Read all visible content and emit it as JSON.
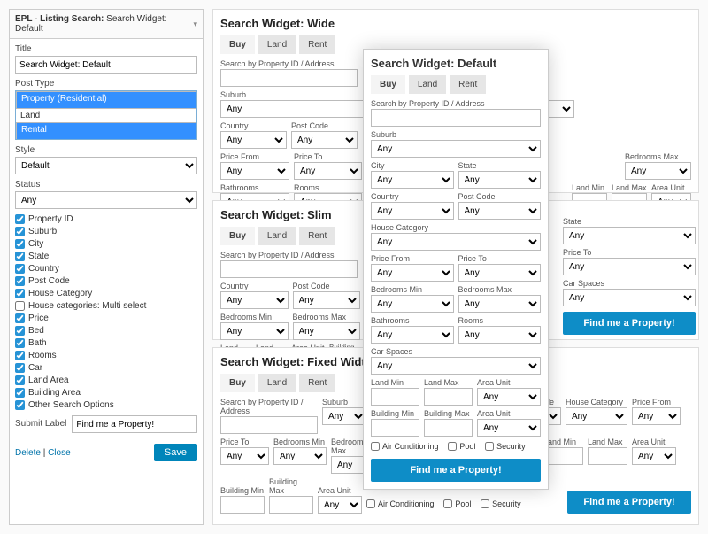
{
  "sidebar": {
    "header_prefix": "EPL - Listing Search:",
    "header_name": "Search Widget: Default",
    "title_label": "Title",
    "title_value": "Search Widget: Default",
    "post_type_label": "Post Type",
    "post_type_options": [
      "Property (Residential)",
      "Land",
      "Rental"
    ],
    "style_label": "Style",
    "style_value": "Default",
    "status_label": "Status",
    "status_value": "Any",
    "checkboxes": [
      {
        "label": "Property ID",
        "checked": true
      },
      {
        "label": "Suburb",
        "checked": true
      },
      {
        "label": "City",
        "checked": true
      },
      {
        "label": "State",
        "checked": true
      },
      {
        "label": "Country",
        "checked": true
      },
      {
        "label": "Post Code",
        "checked": true
      },
      {
        "label": "House Category",
        "checked": true
      },
      {
        "label": "House categories: Multi select",
        "checked": false
      },
      {
        "label": "Price",
        "checked": true
      },
      {
        "label": "Bed",
        "checked": true
      },
      {
        "label": "Bath",
        "checked": true
      },
      {
        "label": "Rooms",
        "checked": true
      },
      {
        "label": "Car",
        "checked": true
      },
      {
        "label": "Land Area",
        "checked": true
      },
      {
        "label": "Building Area",
        "checked": true
      },
      {
        "label": "Other Search Options",
        "checked": true
      }
    ],
    "submit_label_label": "Submit Label",
    "submit_label_value": "Find me a Property!",
    "delete": "Delete",
    "close": "Close",
    "save": "Save"
  },
  "tabs": [
    "Buy",
    "Land",
    "Rent"
  ],
  "any": "Any",
  "search_by_label": "Search by Property ID / Address",
  "labels": {
    "suburb": "Suburb",
    "city": "City",
    "state": "State",
    "country": "Country",
    "postcode": "Post Code",
    "house_cat": "House Category",
    "price_from": "Price From",
    "price_to": "Price To",
    "bed_min": "Bedrooms Min",
    "bed_max": "Bedrooms Max",
    "bath": "Bathrooms",
    "rooms": "Rooms",
    "car": "Car Spaces",
    "land_min": "Land Min",
    "land_max": "Land Max",
    "area_unit": "Area Unit",
    "build_min": "Building Min",
    "build_max": "Building Max",
    "air": "Air Conditioning",
    "pool": "Pool",
    "security": "Security"
  },
  "panels": {
    "wide_title": "Search Widget: Wide",
    "default_title": "Search Widget: Default",
    "slim_title": "Search Widget: Slim",
    "fixed_title": "Search Widget: Fixed Width"
  },
  "find_label": "Find me a Property!"
}
